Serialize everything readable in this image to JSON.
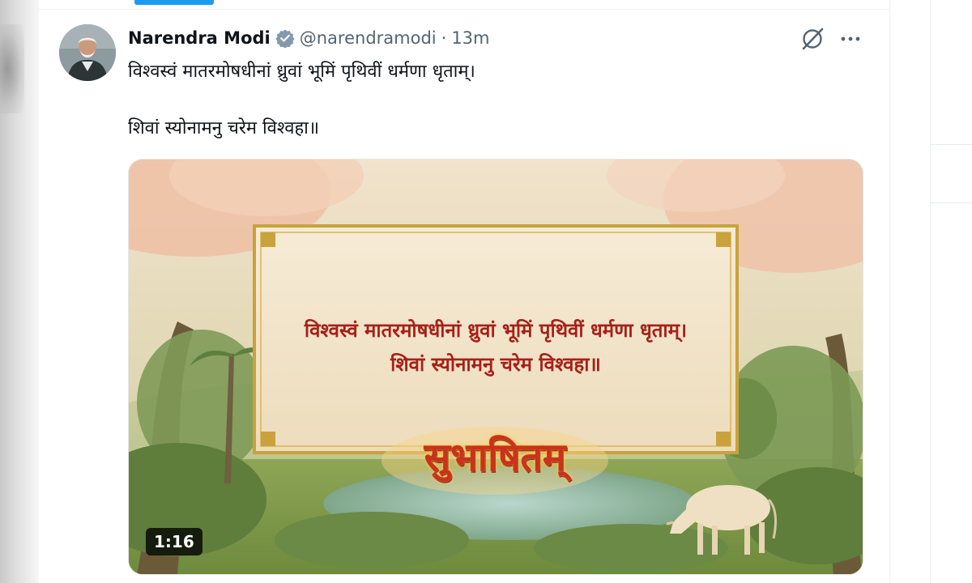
{
  "tweet": {
    "author_name": "Narendra Modi",
    "handle": "@narendramodi",
    "separator": "·",
    "time": "13m",
    "text_line1": "विश्वस्वं मातरमोषधीनां ध्रुवां भूमिं पृथिवीं धर्मणा धृताम्।",
    "text_line2": "शिवां स्योनामनु चरेम विश्वहा॥"
  },
  "media": {
    "kind": "video",
    "frame_line1": "विश्वस्वं मातरमोषधीनां ध्रुवां भूमिं पृथिवीं धर्मणा धृताम्।",
    "frame_line2": "शिवां स्योनामनु चरेम विश्वहा॥",
    "title_art": "सुभाषितम्",
    "duration": "1:16"
  },
  "icons": {
    "verified": "verified-badge-icon",
    "grok": "grok-icon",
    "more": "more-options-icon"
  },
  "colors": {
    "verified_badge": "#829aab",
    "meta_gray": "#536471",
    "text": "#0f1419",
    "accent_blue": "#1d9bf0",
    "frame_text_red": "#a52119",
    "frame_gold": "#c9a23c"
  }
}
